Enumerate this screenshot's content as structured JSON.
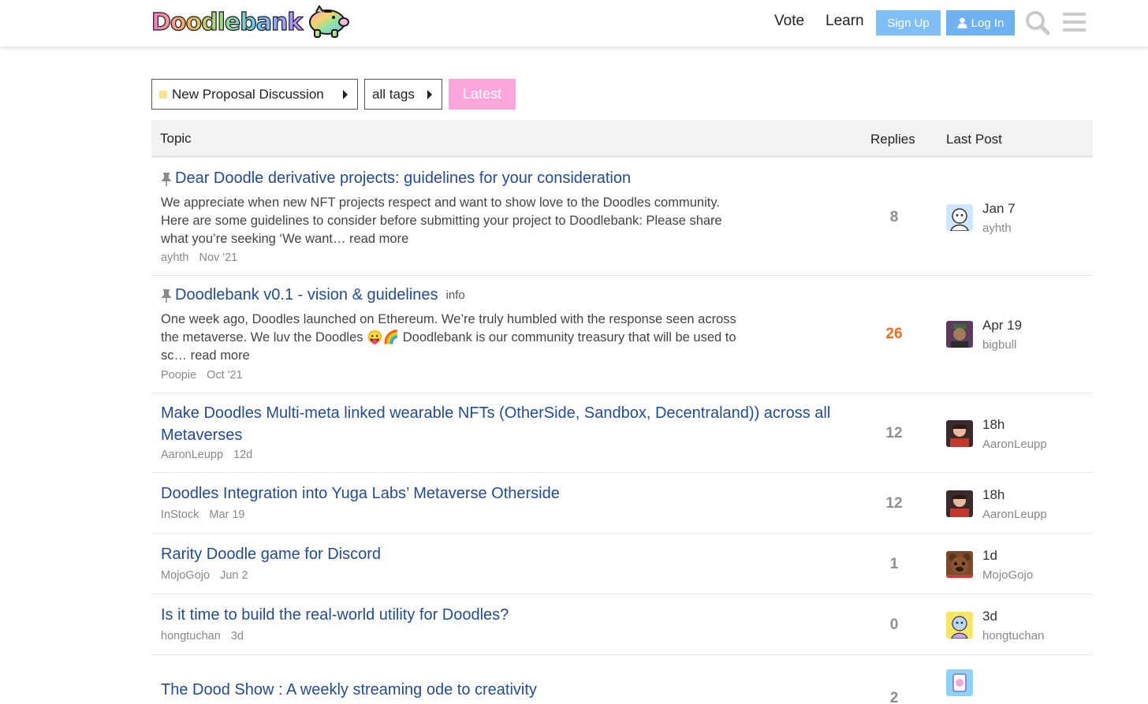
{
  "header": {
    "logo_text": "Doodlebank",
    "nav": [
      {
        "label": "Vote"
      },
      {
        "label": "Learn"
      }
    ],
    "signup_label": "Sign Up",
    "login_label": "Log In"
  },
  "filters": {
    "category_label": "New Proposal Discussion",
    "tags_label": "all tags",
    "latest_label": "Latest"
  },
  "table": {
    "columns": {
      "topic": "Topic",
      "replies": "Replies",
      "last_post": "Last Post"
    },
    "topics": [
      {
        "title": "Dear Doodle derivative projects: guidelines for your consideration",
        "pinned": true,
        "excerpt_lines": [
          "We appreciate when new NFT projects respect and want to show love to the Doodles community.",
          "Here are some guidelines to consider before submitting your project to Doodlebank: Please share",
          "what you’re seeking ‘We want… read more"
        ],
        "author": "ayhth",
        "date": "Nov '21",
        "replies": "8",
        "last_time": "Jan 7",
        "last_user": "ayhth"
      },
      {
        "title": "Doodlebank v0.1 - vision & guidelines",
        "pinned": true,
        "tag": "info",
        "excerpt_lines": [
          "One week ago, Doodles launched on Ethereum. We’re truly humbled with the response seen across",
          "the metaverse. We luv the Doodles 😛🌈 Doodlebank is our community treasury that will be used to",
          "sc… read more"
        ],
        "author": "Poopie",
        "date": "Oct '21",
        "replies": "26",
        "last_time": "Apr 19",
        "last_user": "bigbull"
      },
      {
        "title_lines": [
          "Make Doodles Multi-meta linked wearable NFTs (OtherSide, Sandbox, Decentraland)) across all",
          "Metaverses"
        ],
        "author": "AaronLeupp",
        "date": "12d",
        "replies": "12",
        "last_time": "18h",
        "last_user": "AaronLeupp"
      },
      {
        "title": "Doodles Integration into Yuga Labs’ Metaverse Otherside",
        "author": "InStock",
        "date": "Mar 19",
        "replies": "12",
        "last_time": "18h",
        "last_user": "AaronLeupp"
      },
      {
        "title": "Rarity Doodle game for Discord",
        "author": "MojoGojo",
        "date": "Jun 2",
        "replies": "1",
        "last_time": "1d",
        "last_user": "MojoGojo"
      },
      {
        "title": "Is it time to build the real-world utility for Doodles?",
        "author": "hongtuchan",
        "date": "3d",
        "replies": "0",
        "last_time": "3d",
        "last_user": "hongtuchan"
      },
      {
        "title": "The Dood Show : A weekly streaming ode to creativity",
        "replies": "2"
      }
    ]
  },
  "colors": {
    "link": "#234b96",
    "hot_replies": "#f36b1c",
    "latest_button": "#fba6dc",
    "signup_button": "#7fbff5",
    "login_button": "#6fb2f2"
  }
}
